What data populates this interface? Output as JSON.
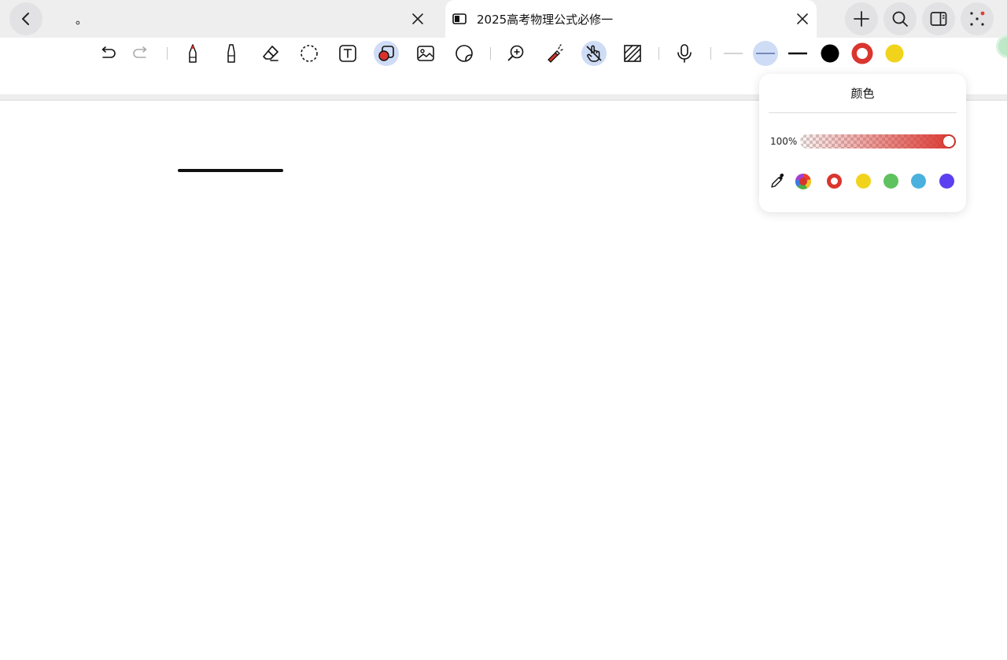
{
  "tabs": [
    {
      "title": "。"
    },
    {
      "title": "2025高考物理公式必修一"
    }
  ],
  "toolbar": {
    "tools": [
      "undo-icon",
      "redo-icon",
      "pen-icon",
      "highlighter-icon",
      "eraser-icon",
      "lasso-icon",
      "text-box-icon",
      "shape-icon",
      "image-icon",
      "sticker-icon",
      "zoom-in-icon",
      "laser-pointer-icon",
      "touch-draw-icon",
      "pattern-fill-icon",
      "microphone-icon"
    ],
    "colors": [
      "#000000",
      "#da352e",
      "#f2d31b"
    ]
  },
  "color_popover": {
    "title": "颜色",
    "opacity_label": "100%",
    "opacity_value": 1.0,
    "current_color": "#da352e",
    "swatches": [
      "#da352e",
      "#f2d31b",
      "#5ec25e",
      "#4ab1df",
      "#5b3ff0"
    ]
  }
}
